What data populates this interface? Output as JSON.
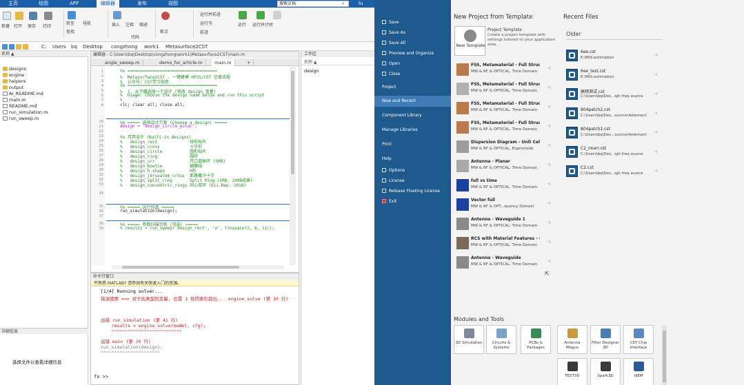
{
  "matlab": {
    "tabs": [
      "主页",
      "绘图",
      "APP",
      "编辑器",
      "发布",
      "视图"
    ],
    "search_placeholder": "搜索文档",
    "user": "lu",
    "ribbon_labels": [
      "新建",
      "打开",
      "保存",
      "打印",
      "转至",
      "查找",
      "导航",
      "插入",
      "注释",
      "缩进",
      "代码",
      "断点",
      "运行",
      "运行并前进",
      "运行节",
      "前进",
      "运行并计时"
    ],
    "path": [
      "C:",
      "Users",
      "bq",
      "Desktop",
      "congzhong",
      "work1",
      "Metasurface2CST"
    ],
    "file_browser": {
      "header": "名称 ▲",
      "items": [
        {
          "name": "designs",
          "type": "folder"
        },
        {
          "name": "engine",
          "type": "folder"
        },
        {
          "name": "helpers",
          "type": "folder"
        },
        {
          "name": "output",
          "type": "folder"
        },
        {
          "name": "AI_README.md",
          "type": "file"
        },
        {
          "name": "main.m",
          "type": "file"
        },
        {
          "name": "README.md",
          "type": "file"
        },
        {
          "name": "run_simulation.m",
          "type": "file"
        },
        {
          "name": "run_sweep.m",
          "type": "file"
        }
      ],
      "detail_header": "详细信息",
      "detail_msg": "选择文件以查看详细信息"
    },
    "editor": {
      "header": "编辑器 - C:\\Users\\bq\\Desktop\\congzhong\\work1\\Metasurface2CST\\main.m",
      "tabs": [
        "angle_sweep.m",
        "demo_for_article.m",
        "main.m",
        "+"
      ],
      "lines": [
        {
          "n": "1",
          "t": "%% ====================================",
          "c": "cmt"
        },
        {
          "n": "2",
          "t": "%  Metasurface2CST - 一键建模 HFSS/CST 仿真流程",
          "c": "cmt"
        },
        {
          "n": "3",
          "t": "%  公众号: CST学习指南",
          "c": "cmt"
        },
        {
          "n": "4",
          "t": "%% ====================================",
          "c": "cmt"
        },
        {
          "n": "5",
          "t": "%  1. 从下面选择一个设计 (修改 design 变量)",
          "c": "cmt"
        },
        {
          "n": "6",
          "t": "%  Usage: Choose the design name below and run this script",
          "c": "cmt"
        },
        {
          "n": "7",
          "t": "%",
          "c": "cmt"
        },
        {
          "n": "8",
          "t": "clc; clear all; close all;",
          "c": ""
        },
        {
          "n": "20",
          "t": "%% ===== 选择设计方案 (Choose a design) =====",
          "c": "cmt"
        },
        {
          "n": "21",
          "t": "design = 'design_circle_polar';",
          "c": "str"
        },
        {
          "n": "22",
          "t": "",
          "c": ""
        },
        {
          "n": "23",
          "t": "%% 可用设计 (Built-in designs)",
          "c": "cmt"
        },
        {
          "n": "24",
          "t": "%   design_rect             矩形贴片",
          "c": "cmt"
        },
        {
          "n": "25",
          "t": "%   design_cross            十字形",
          "c": "cmt"
        },
        {
          "n": "26",
          "t": "%   design_circle           圆形贴片",
          "c": "cmt"
        },
        {
          "n": "27",
          "t": "%   design_ring             圆环",
          "c": "cmt"
        },
        {
          "n": "28",
          "t": "%   design_srr              开口谐振环 (SRR)",
          "c": "cmt"
        },
        {
          "n": "29",
          "t": "%   design_bowtie           蝴蝶结",
          "c": "cmt"
        },
        {
          "n": "30",
          "t": "%   design_h_shape          H形",
          "c": "cmt"
        },
        {
          "n": "31",
          "t": "%   design_jerusalem_cross  耶路撒冷十字",
          "c": "cmt"
        },
        {
          "n": "32",
          "t": "%   design_split_ring       Split Ring (SRR, 2008经典)",
          "c": "cmt"
        },
        {
          "n": "33",
          "t": "%   design_concentric_rings 同心双环 (Sci.Rep. 2018)",
          "c": "cmt"
        },
        {
          "n": "34",
          "t": "",
          "c": ""
        },
        {
          "n": "35",
          "t": "%% ===== 运行仿真 =====",
          "c": "cmt"
        },
        {
          "n": "36",
          "t": "run_simulation(design);",
          "c": ""
        },
        {
          "n": "37",
          "t": "",
          "c": ""
        },
        {
          "n": "38",
          "t": "%% ===== 参数扫描示例 (可选) =====",
          "c": "cmt"
        },
        {
          "n": "39",
          "t": "% results = run_sweep('design_rect', 'a', linspace(2, 6, 11));",
          "c": "cmt"
        }
      ]
    },
    "workspace": {
      "header": "工作区",
      "col": "名称 ▲",
      "row": "design"
    },
    "command": {
      "header": "命令行窗口",
      "notice": "不熟悉 MATLAB? 请参阅有关快速入门的资源。",
      "lines": [
        {
          "t": "[1/4] Running solver...",
          "c": ""
        },
        {
          "t": "错误使用 ==> 对于此类型的变量, 位置 1 处的索引超出... engine_solve (第 20 行)",
          "c": "err"
        },
        {
          "t": "",
          "c": ""
        },
        {
          "t": "",
          "c": ""
        },
        {
          "t": "出错 run_simulation (第 41 行)",
          "c": "err"
        },
        {
          "t": "    results = engine_solve(model, cfg);",
          "c": "err"
        },
        {
          "t": "    ^^^^^^^^^^^^^^^^^^^^^^^^^^",
          "c": "err"
        },
        {
          "t": "出错 main (第 20 行)",
          "c": "err"
        },
        {
          "t": "run_simulation(design);",
          "c": "gray"
        },
        {
          "t": "^^^^^^^^^^^^^^^^^^^^^^",
          "c": "gray"
        }
      ],
      "prompt": "fx >>"
    }
  },
  "cst": {
    "sidebar": {
      "items": [
        "Save",
        "Save As",
        "Save All",
        "Preview and Organize",
        "Open",
        "Close",
        "Project",
        "New and Recent",
        "Component Library",
        "Manage Libraries",
        "Print",
        "Help",
        "Options",
        "License",
        "Release Floating License",
        "Exit"
      ]
    },
    "new_project": {
      "title": "New Project from Template",
      "new_template_label": "New Template",
      "desc_title": "Project Template",
      "desc": "Create a project template with settings tailored to your application area.",
      "templates": [
        {
          "name": "FSS, Metamaterial - Full Structu...",
          "sub": "MW & RF & OPTICAL, Time Domain",
          "color": "#b87a4b"
        },
        {
          "name": "FSS, Metamaterial - Full Structu...",
          "sub": "MW & RF & OPTICAL, Time Domain",
          "color": "#b0b0b0"
        },
        {
          "name": "FSS, Metamaterial - Full Structu...",
          "sub": "MW & RF & OPTICAL, Time Domain",
          "color": "#b87a4b"
        },
        {
          "name": "FSS, Metamaterial - Full Structure",
          "sub": "MW & RF & OPTICAL, Time Domain",
          "color": "#b87a4b"
        },
        {
          "name": "Dispersion Diagram - Unit Cell",
          "sub": "MW & RF & OPTICAL, Eigenmode",
          "color": "#9c9c9c"
        },
        {
          "name": "Antenna - Planar",
          "sub": "MW & RF & OPTICAL, Time Domain",
          "color": "#a8a8a8"
        },
        {
          "name": "full vs time",
          "sub": "MW & RF & OPTICAL, Time Domain",
          "color": "#1b3f9e"
        },
        {
          "name": "Vector full",
          "sub": "MW & RF & OPT...quency Domain",
          "color": "#1b3f9e"
        },
        {
          "name": "Antenna - Waveguide 1",
          "sub": "MW & RF & OPTICAL, Time Domain",
          "color": "#8a8a8a"
        },
        {
          "name": "RCS with Material Features - S...",
          "sub": "MW & RF & OPTICAL, Time Domain",
          "color": "#7a6a5a"
        },
        {
          "name": "Antenna - Waveguide",
          "sub": "MW & RF & OPTICAL, Time Domain",
          "color": "#8a8a8a"
        }
      ]
    },
    "recent": {
      "title": "Recent Files",
      "group": "Older",
      "files": [
        {
          "name": "6ee.cst",
          "path": "E:\\MIX-estimation"
        },
        {
          "name": "6ee_test.cst",
          "path": "E:\\MIX-estimation"
        },
        {
          "name": "高频测试.cst",
          "path": "C:\\Users\\bq\\Des...igh freq source"
        },
        {
          "name": "804patch2.cst",
          "path": "C:\\Users\\bq\\Des...source\\4element"
        },
        {
          "name": "804patch1.cst",
          "path": "C:\\Users\\bq\\Des...source\\4element"
        },
        {
          "name": "C2_noarr.cst",
          "path": "C:\\Users\\bq\\Des...igh freq source"
        },
        {
          "name": "C2.cst",
          "path": "C:\\Users\\bq\\Des...igh freq source"
        }
      ]
    },
    "modules": {
      "title": "Modules and Tools",
      "items": [
        {
          "label": "3D Simulation",
          "color": "#7d8a96"
        },
        {
          "label": "Circuits & Systems",
          "color": "#7aa3c7"
        },
        {
          "label": "PCBs & Packages",
          "color": "#3a8a55"
        },
        {
          "label": "Antenna Magus",
          "color": "#c89a3c"
        },
        {
          "label": "Filter Designer 3D",
          "color": "#4a7eb0"
        },
        {
          "label": "CST Chip Interface",
          "color": "#5a8ac0"
        },
        {
          "label": "FEST3D",
          "color": "#3a3a3a"
        },
        {
          "label": "Spark3D",
          "color": "#3a3a3a"
        },
        {
          "label": "IdEM",
          "color": "#2a5a9a"
        }
      ]
    }
  }
}
